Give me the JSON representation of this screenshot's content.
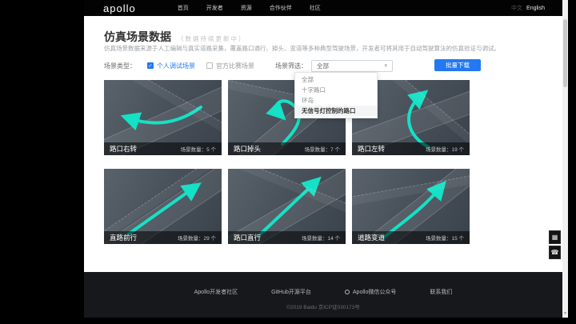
{
  "colors": {
    "accent_blue": "#2478f2",
    "arrow_teal": "#14e1c6",
    "header_bg": "#030303",
    "footer_bg": "#17181b"
  },
  "header": {
    "logo": "apollo",
    "nav": [
      "首页",
      "开发者",
      "资源",
      "合作伙伴",
      "社区"
    ],
    "lang_zh": "中文",
    "lang_en": "English"
  },
  "page": {
    "title": "仿真场景数据",
    "subtitle": "（数据持续更新中）",
    "description": "仿真场景数据来源于人工编辑与真实道路采集，覆盖路口通行、掉头、变道等多种典型驾驶场景，开发者可将其用于自动驾驶算法的仿真验证与调试。"
  },
  "filters": {
    "type_label": "场景类型：",
    "option1": "个人调试场景",
    "option2": "官方比赛场景",
    "check_glyph": "✓",
    "filter_label": "场景筛选：",
    "select_value": "全部",
    "caret_glyph": "▾",
    "download_button": "批量下载",
    "dropdown_options": [
      "全部",
      "十字路口",
      "环岛",
      "无信号灯控制的路口"
    ]
  },
  "cards": [
    {
      "name": "路口右转",
      "meta": "场景数量：5 个"
    },
    {
      "name": "路口掉头",
      "meta": "场景数量：7 个"
    },
    {
      "name": "路口左转",
      "meta": "场景数量：19 个"
    },
    {
      "name": "直路前行",
      "meta": "场景数量：29 个"
    },
    {
      "name": "路口直行",
      "meta": "场景数量：14 个"
    },
    {
      "name": "道路变道",
      "meta": "场景数量：15 个"
    }
  ],
  "footer": {
    "links": [
      "Apollo开发者社区",
      "GitHub开源平台",
      "Apollo微信公众号",
      "联系我们"
    ],
    "copyright": "©2019 Baidu 京ICP证030173号"
  },
  "icons": {
    "qr_code": "▦",
    "contact": "☎",
    "scroll_down": "▾"
  }
}
